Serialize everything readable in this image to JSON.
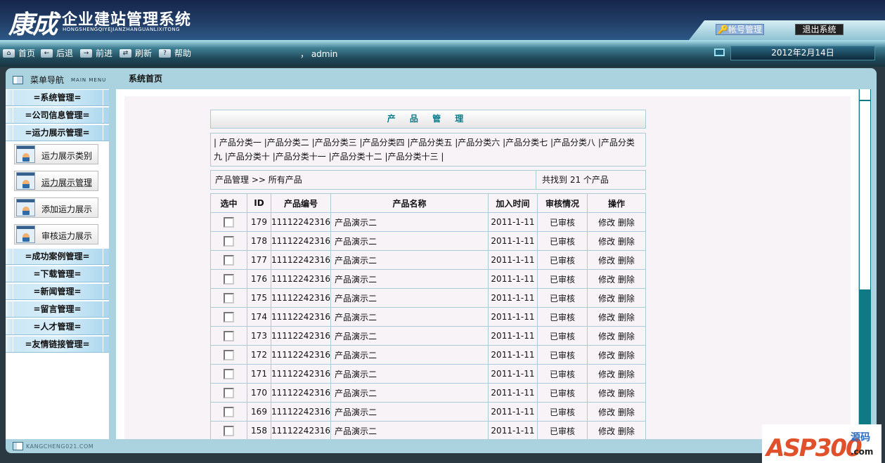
{
  "header": {
    "logo_cn": "康成",
    "title": "企业建站管理系统",
    "pinyin": "HONGSHENGQIYEJIANZHANGUANLIXITONG",
    "account_btn": "🔑帐号管理",
    "logout_btn": "退出系统"
  },
  "toolbar": {
    "items": [
      {
        "icon": "home-icon",
        "label": "首页",
        "glyph": "⌂"
      },
      {
        "icon": "back-arrow-icon",
        "label": "后退",
        "glyph": "←"
      },
      {
        "icon": "forward-arrow-icon",
        "label": "前进",
        "glyph": "→"
      },
      {
        "icon": "refresh-icon",
        "label": "刷新",
        "glyph": "⇄"
      },
      {
        "icon": "help-icon",
        "label": "帮助",
        "glyph": "?"
      }
    ],
    "user": "， admin",
    "date": "2012年2月14日"
  },
  "nav": {
    "title": "菜单导航",
    "subtitle": "MAIN MENU",
    "page_heading": "系统首页"
  },
  "sidebar": {
    "groups_top": [
      "=系统管理=",
      "=公司信息管理=",
      "=运力展示管理="
    ],
    "sub_items": [
      "运力展示类别",
      "运力展示管理",
      "添加运力展示",
      "审核运力展示"
    ],
    "groups_bottom": [
      "=成功案例管理=",
      "=下载管理=",
      "=新闻管理=",
      "=留言管理=",
      "=人才管理=",
      "=友情链接管理="
    ]
  },
  "main": {
    "title": "产 品 管 理",
    "categories": [
      "产品分类一",
      "产品分类二",
      "产品分类三",
      "产品分类四",
      "产品分类五",
      "产品分类六",
      "产品分类七",
      "产品分类八",
      "产品分类九",
      "产品分类十",
      "产品分类十一",
      "产品分类十二",
      "产品分类十三"
    ],
    "crumb": "产品管理  >> 所有产品",
    "found": "共找到  21 个产品",
    "columns": [
      "选中",
      "ID",
      "产品编号",
      "产品名称",
      "加入时间",
      "审核情况",
      "操作"
    ],
    "rows": [
      {
        "id": "179",
        "code": "11112242316",
        "name": "产品演示二",
        "date": "2011-1-11",
        "status": "已审核"
      },
      {
        "id": "178",
        "code": "11112242316",
        "name": "产品演示二",
        "date": "2011-1-11",
        "status": "已审核"
      },
      {
        "id": "177",
        "code": "11112242316",
        "name": "产品演示二",
        "date": "2011-1-11",
        "status": "已审核"
      },
      {
        "id": "176",
        "code": "11112242316",
        "name": "产品演示二",
        "date": "2011-1-11",
        "status": "已审核"
      },
      {
        "id": "175",
        "code": "11112242316",
        "name": "产品演示二",
        "date": "2011-1-11",
        "status": "已审核"
      },
      {
        "id": "174",
        "code": "11112242316",
        "name": "产品演示二",
        "date": "2011-1-11",
        "status": "已审核"
      },
      {
        "id": "173",
        "code": "11112242316",
        "name": "产品演示二",
        "date": "2011-1-11",
        "status": "已审核"
      },
      {
        "id": "172",
        "code": "11112242316",
        "name": "产品演示二",
        "date": "2011-1-11",
        "status": "已审核"
      },
      {
        "id": "171",
        "code": "11112242316",
        "name": "产品演示二",
        "date": "2011-1-11",
        "status": "已审核"
      },
      {
        "id": "170",
        "code": "11112242316",
        "name": "产品演示二",
        "date": "2011-1-11",
        "status": "已审核"
      },
      {
        "id": "169",
        "code": "11112242316",
        "name": "产品演示二",
        "date": "2011-1-11",
        "status": "已审核"
      },
      {
        "id": "158",
        "code": "11112242316",
        "name": "产品演示二",
        "date": "2011-1-11",
        "status": "已审核"
      }
    ],
    "edit": "修改",
    "delete": "删除"
  },
  "footer": {
    "site": "KANGCHENG021.COM"
  },
  "watermark": {
    "text": "ASP300",
    "cn": "源码",
    "com": ".com"
  }
}
